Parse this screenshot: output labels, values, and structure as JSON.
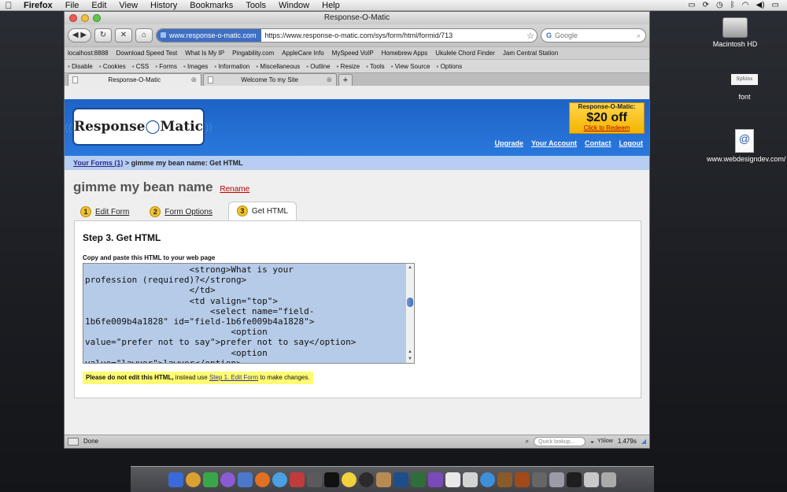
{
  "menubar": {
    "app": "Firefox",
    "items": [
      "File",
      "Edit",
      "View",
      "History",
      "Bookmarks",
      "Tools",
      "Window",
      "Help"
    ]
  },
  "desktop": {
    "icons": [
      {
        "label": "Macintosh HD",
        "icon": "hard-drive-icon"
      },
      {
        "label": "font",
        "icon": "font-file-icon",
        "thumb_text": "Sphinx"
      },
      {
        "label": "www.webdesigndev.com/",
        "icon": "webloc-icon",
        "thumb_text": "@"
      }
    ]
  },
  "browser": {
    "window_title": "Response-O-Matic",
    "site_badge": "www.response-o-matic.com",
    "url": "https://www.response-o-matic.com/sys/form/html/formid/713",
    "search_placeholder": "Google",
    "bookmarks": [
      "localhost:8888",
      "Download Speed Test",
      "What Is My IP",
      "Pingability.com",
      "AppleCare Info",
      "MySpeed VoIP",
      "Homebrew Apps",
      "Ukulele Chord Finder",
      "Jam Central Station"
    ],
    "dev_toolbar": [
      "Disable",
      "Cookies",
      "CSS",
      "Forms",
      "Images",
      "Information",
      "Miscellaneous",
      "Outline",
      "Resize",
      "Tools",
      "View Source",
      "Options"
    ],
    "tabs": [
      {
        "label": "Response-O-Matic",
        "active": true
      },
      {
        "label": "Welcome To my Site",
        "active": false
      }
    ],
    "status": {
      "text": "Done",
      "lookup_placeholder": "Quick lookup...",
      "yslow": "YSlow",
      "time": "1.479s"
    }
  },
  "site": {
    "logo_text": [
      "Response",
      "Matic"
    ],
    "promo": {
      "line1": "Response-O-Matic:",
      "line2": "$20 off",
      "line3": "Click to Redeem"
    },
    "nav": [
      "Upgrade",
      "Your Account",
      "Contact",
      "Logout"
    ],
    "breadcrumb": {
      "link": "Your Forms (1)",
      "separator": " > ",
      "current": "gimme my bean name: Get HTML"
    },
    "title": "gimme my bean name",
    "rename": "Rename",
    "steps": [
      {
        "num": "1",
        "label": "Edit Form"
      },
      {
        "num": "2",
        "label": "Form Options"
      },
      {
        "num": "3",
        "label": "Get HTML"
      }
    ],
    "panel": {
      "heading": "Step 3. Get HTML",
      "copy_label": "Copy and paste this HTML to your web page",
      "code": "                    <strong>What is your\nprofession (required)?</strong>\n                    </td>\n                    <td valign=\"top\">\n                        <select name=\"field-\n1b6fe009b4a1828\" id=\"field-1b6fe009b4a1828\">\n                            <option\nvalue=\"prefer not to say\">prefer not to say</option>\n                            <option\nvalue=\"lawyer\">lawyer</option>",
      "notice_bold": "Please do not edit this HTML,",
      "notice_mid": " instead use ",
      "notice_link": "Step 1. Edit Form",
      "notice_end": " to make changes."
    }
  },
  "colors": {
    "header_blue": "#2a78dd",
    "breadcrumb_bg": "#b7cef2",
    "promo_yellow": "#f5b400",
    "notice_yellow": "#fffb72",
    "step_badge": "#f2c22e",
    "selection": "#b5cbe8"
  }
}
